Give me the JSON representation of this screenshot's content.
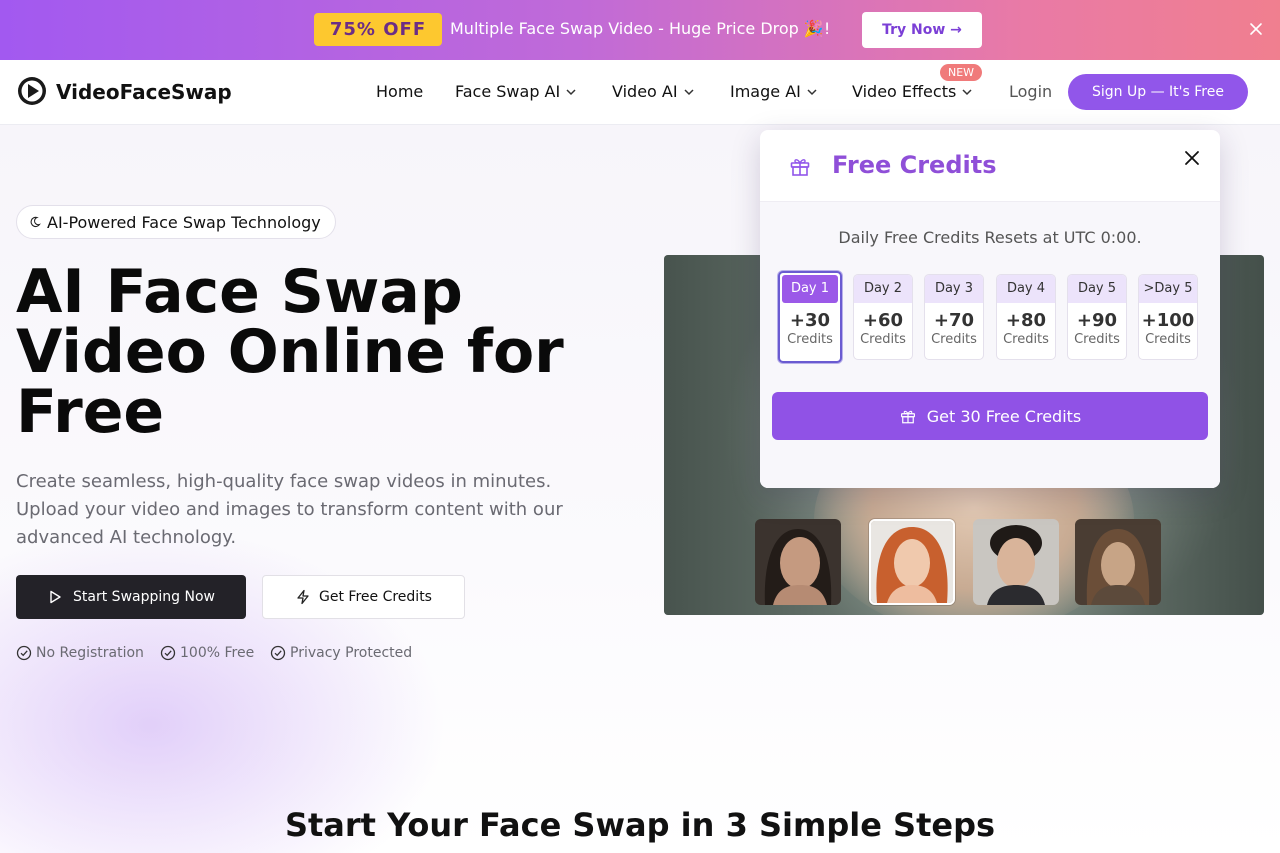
{
  "promo": {
    "badge": "75% OFF",
    "text": "Multiple Face Swap Video - Huge Price Drop 🎉!",
    "cta": "Try Now →"
  },
  "nav": {
    "brand": "VideoFaceSwap",
    "items": [
      "Home",
      "Face Swap AI",
      "Video AI",
      "Image AI",
      "Video Effects"
    ],
    "new_badge": "NEW",
    "login": "Login",
    "signup": "Sign Up — It's Free"
  },
  "hero": {
    "chip": "AI-Powered Face Swap Technology",
    "title": "AI Face Swap Video Online for Free",
    "description": "Create seamless, high-quality face swap videos in minutes. Upload your video and images to transform content with our advanced AI technology.",
    "primary_cta": "Start Swapping Now",
    "secondary_cta": "Get Free Credits",
    "features": [
      "No Registration",
      "100% Free",
      "Privacy Protected"
    ]
  },
  "popup": {
    "title": "Free Credits",
    "reset_note": "Daily Free Credits Resets at UTC 0:00.",
    "days": [
      {
        "label": "Day 1",
        "value": "+30",
        "unit": "Credits"
      },
      {
        "label": "Day 2",
        "value": "+60",
        "unit": "Credits"
      },
      {
        "label": "Day 3",
        "value": "+70",
        "unit": "Credits"
      },
      {
        "label": "Day 4",
        "value": "+80",
        "unit": "Credits"
      },
      {
        "label": "Day 5",
        "value": "+90",
        "unit": "Credits"
      },
      {
        "label": ">Day 5",
        "value": "+100",
        "unit": "Credits"
      }
    ],
    "cta": "Get 30 Free Credits"
  },
  "steps": {
    "title": "Start Your Face Swap in 3 Simple Steps"
  },
  "colors": {
    "accent": "#9156ea",
    "promo_badge": "#fdc82f",
    "dark_button": "#232228"
  }
}
